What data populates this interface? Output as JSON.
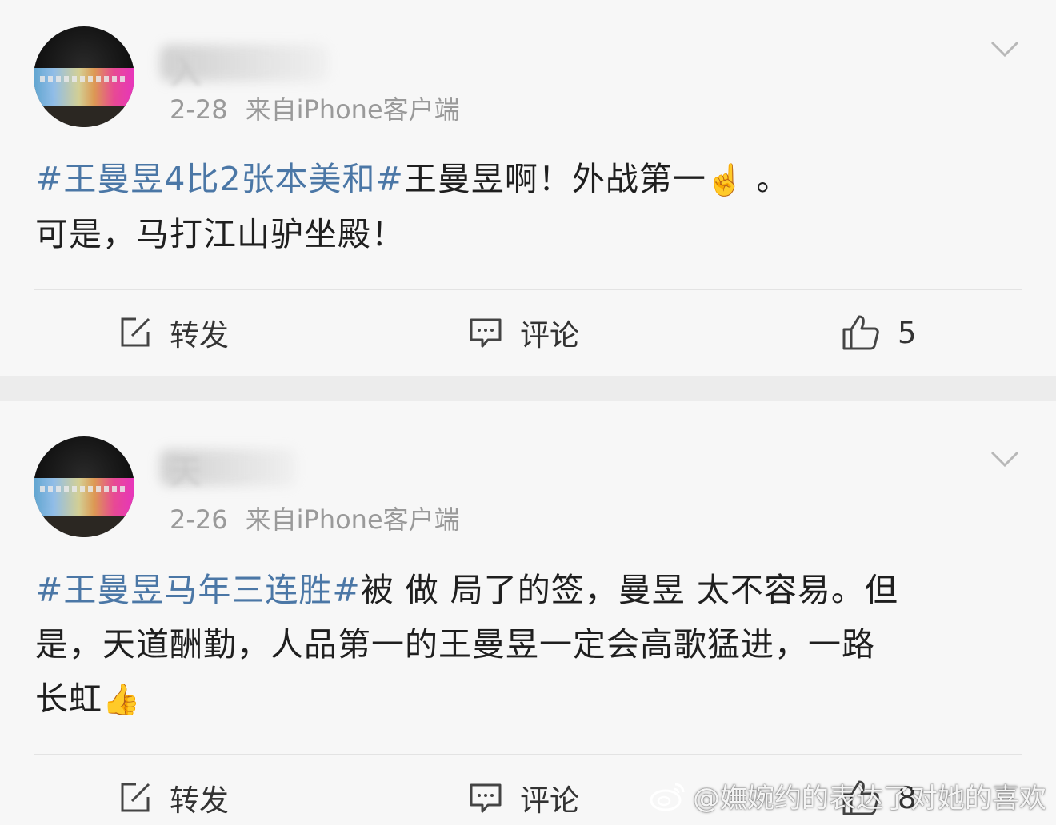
{
  "posts": [
    {
      "username": "入",
      "date": "2-28",
      "source": "来自iPhone客户端",
      "content_line1": {
        "topic1": "#王曼昱4比2张本美和#",
        "text": "王曼昱啊！外战第一",
        "emoji": "☝️",
        "tail": "。"
      },
      "content_line2": "可是，马打江山驴坐殿！",
      "actions": {
        "repost": "转发",
        "comment": "评论",
        "like_count": "5"
      }
    },
    {
      "username": "天",
      "date": "2-26",
      "source": "来自iPhone客户端",
      "content": {
        "topic": "#王曼昱马年三连胜#",
        "line1_text": "被 做 局了的签，曼昱 太不容易。但",
        "line2": "是，天道酬勤，人品第一的王曼昱一定会高歌猛进，一路",
        "line3": "长虹",
        "emoji": "👍"
      },
      "actions": {
        "repost": "转发",
        "comment": "评论",
        "like_count": "8"
      }
    }
  ],
  "watermark": "@嫵婉约的表达了对她的喜欢",
  "icons": {
    "more": "chevron-down-icon",
    "repost": "repost-edit-icon",
    "comment": "comment-bubble-icon",
    "like": "thumbs-up-icon"
  },
  "colors": {
    "topic": "#4b77a6",
    "meta": "#9a9a9a",
    "background": "#f7f7f7"
  }
}
